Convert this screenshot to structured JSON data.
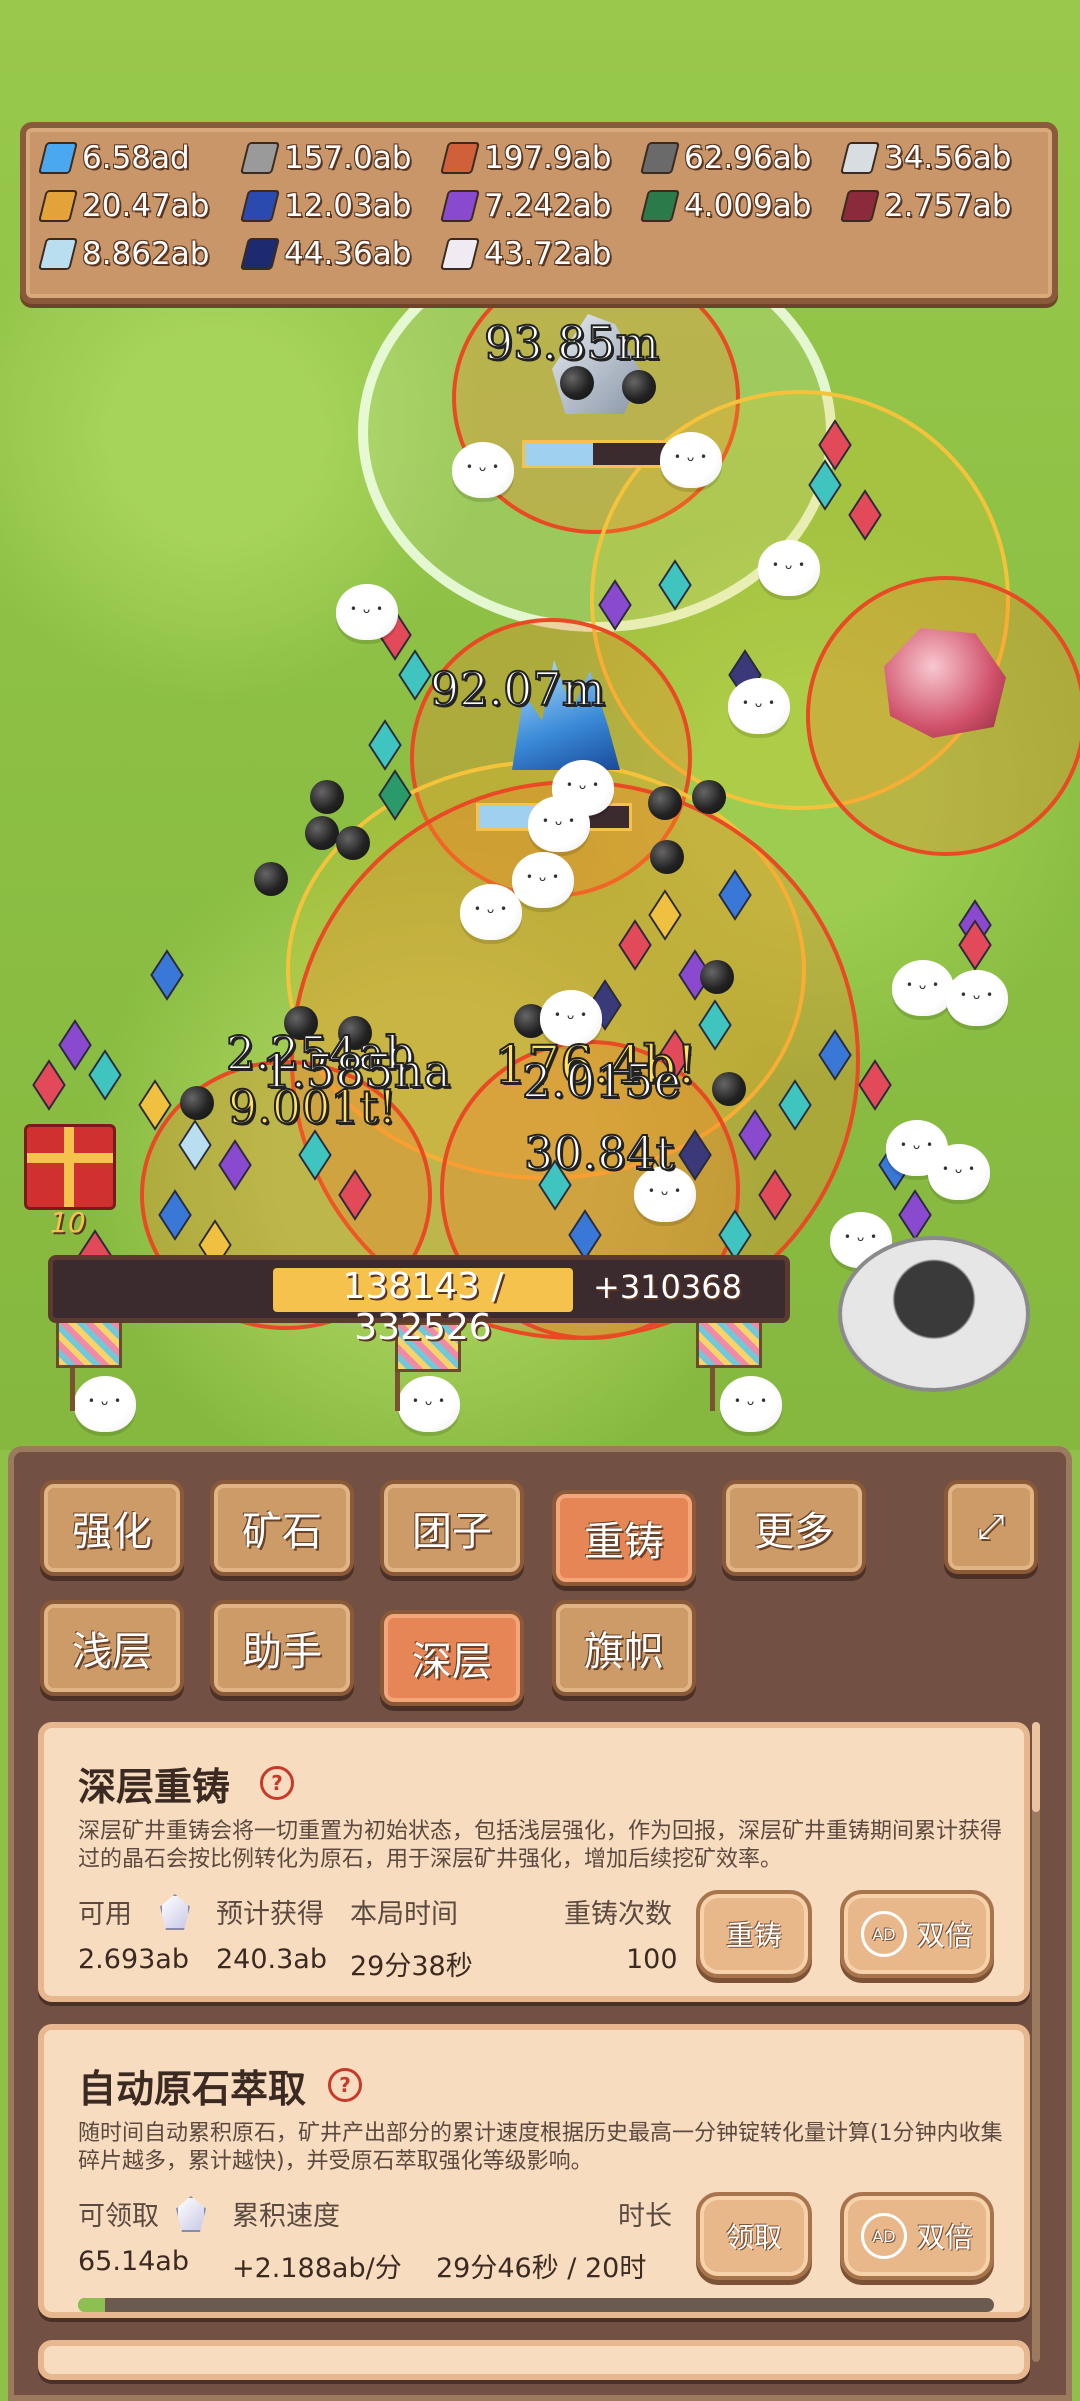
{
  "resources": [
    {
      "icon": "diamond-gem-icon",
      "color": "#4aa8f0",
      "value": "6.58ad"
    },
    {
      "icon": "gray-ingot-icon",
      "color": "#9a9a9a",
      "value": "157.0ab"
    },
    {
      "icon": "copper-ingot-icon",
      "color": "#d0603a",
      "value": "197.9ab"
    },
    {
      "icon": "dark-gray-ingot-icon",
      "color": "#6a6a6a",
      "value": "62.96ab"
    },
    {
      "icon": "silver-ingot-icon",
      "color": "#d8dde2",
      "value": "34.56ab"
    },
    {
      "icon": "gold-ingot-icon",
      "color": "#e3a33a",
      "value": "20.47ab"
    },
    {
      "icon": "blue-ingot-icon",
      "color": "#2a4ab0",
      "value": "12.03ab"
    },
    {
      "icon": "purple-ingot-icon",
      "color": "#8a4ad0",
      "value": "7.242ab"
    },
    {
      "icon": "green-ingot-icon",
      "color": "#2a7a4a",
      "value": "4.009ab"
    },
    {
      "icon": "crimson-ingot-icon",
      "color": "#8a2a3a",
      "value": "2.757ab"
    },
    {
      "icon": "ice-ingot-icon",
      "color": "#b8def0",
      "value": "8.862ab"
    },
    {
      "icon": "navy-ingot-icon",
      "color": "#1e2a70",
      "value": "44.36ab"
    },
    {
      "icon": "white-ingot-icon",
      "color": "#f0eaf2",
      "value": "43.72ab"
    }
  ],
  "floating_numbers": {
    "top": "93.85m",
    "middle": "92.07m",
    "left_a": "2.254ab",
    "left_b": "1.585na",
    "left_c": "9.001t!",
    "center_a": "176.4b!",
    "center_b": "2.015e",
    "lower": "30.84t"
  },
  "gift_count": "10",
  "progress": {
    "current_total": "138143 / 332526",
    "fraction": 0.415,
    "gain": "+310368"
  },
  "tabs_row1": [
    "强化",
    "矿石",
    "团子",
    "重铸",
    "更多"
  ],
  "tabs_row2": [
    "浅层",
    "助手",
    "深层",
    "旗帜"
  ],
  "active_tab_row1": "重铸",
  "active_tab_row2": "深层",
  "card_reforge": {
    "title": "深层重铸",
    "help": "?",
    "description": "深层矿井重铸会将一切重置为初始状态，包括浅层强化，作为回报，深层矿井重铸期间累计获得过的晶石会按比例转化为原石，用于深层矿井强化，增加后续挖矿效率。",
    "labels": {
      "available": "可用",
      "expected": "预计获得",
      "session_time": "本局时间",
      "count": "重铸次数"
    },
    "values": {
      "available": "2.693ab",
      "expected": "240.3ab",
      "session_time": "29分38秒",
      "count": "100"
    },
    "button_reforge": "重铸",
    "button_double": "双倍",
    "ad_label": "AD"
  },
  "card_auto": {
    "title": "自动原石萃取",
    "help": "?",
    "description": "随时间自动累积原石，矿井产出部分的累计速度根据历史最高一分钟锭转化量计算(1分钟内收集碎片越多，累计越快)，并受原石萃取强化等级影响。",
    "labels": {
      "claimable": "可领取",
      "rate": "累积速度",
      "duration": "时长"
    },
    "values": {
      "claimable": "65.14ab",
      "rate": "+2.188ab/分",
      "duration": "29分46秒 / 20时"
    },
    "fill": 0.03,
    "button_claim": "领取",
    "button_double": "双倍",
    "ad_label": "AD"
  },
  "colors": {
    "accent": "#e68656",
    "panel": "#725043",
    "card": "#f8dcc0",
    "progress_fill": "#f4c24d"
  }
}
